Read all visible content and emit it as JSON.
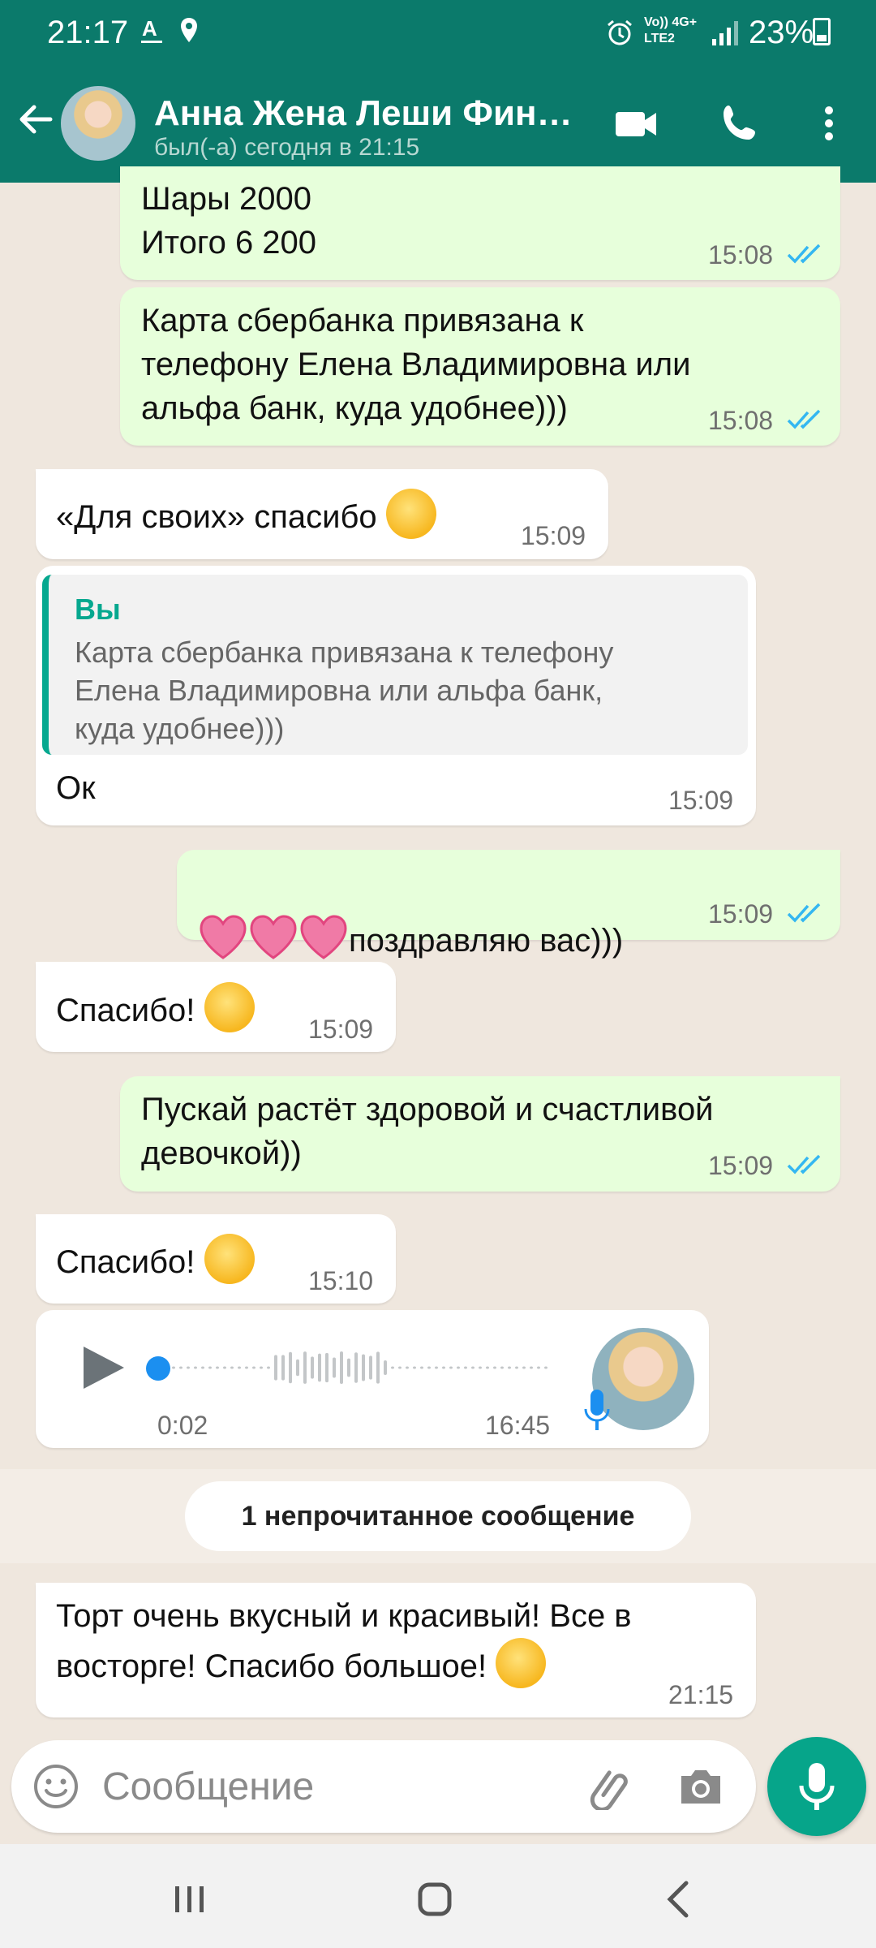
{
  "status_bar": {
    "time": "21:17",
    "network_top": "Vo)) 4G+",
    "network_bottom": "LTE2",
    "battery": "23%"
  },
  "header": {
    "contact_name": "Анна Жена Леши Фин…",
    "last_seen": "был(-а) сегодня в 21:15"
  },
  "messages": [
    {
      "id": "m1",
      "direction": "out",
      "text": "Шары 2000\nИтого 6 200",
      "time": "15:08",
      "status": "read"
    },
    {
      "id": "m2",
      "direction": "out",
      "text": "Карта сбербанка привязана к\nтелефону Елена Владимировна или\nальфа банк,  куда удобнее)))",
      "time": "15:08",
      "status": "read"
    },
    {
      "id": "m3",
      "direction": "in",
      "text": "«Для своих» спасибо",
      "emoji": "hugging-face",
      "time": "15:09"
    },
    {
      "id": "m4",
      "direction": "in",
      "quote_author": "Вы",
      "quote_text": "Карта сбербанка привязана к телефону\nЕлена Владимировна или альфа банк,\nкуда удобнее)))",
      "text": "Ок",
      "time": "15:09"
    },
    {
      "id": "m5",
      "direction": "out",
      "emoji": "pink-heart x3",
      "text": "поздравляю вас)))",
      "time": "15:09",
      "status": "read"
    },
    {
      "id": "m6",
      "direction": "in",
      "text": "Спасибо!",
      "emoji": "smiling-face",
      "time": "15:09"
    },
    {
      "id": "m7",
      "direction": "out",
      "text": "Пускай растёт здоровой и счастливой\nдевочкой))",
      "time": "15:09",
      "status": "read"
    },
    {
      "id": "m8",
      "direction": "in",
      "text": "Спасибо!",
      "emoji": "kissing-face",
      "time": "15:10"
    },
    {
      "id": "m9",
      "direction": "in",
      "type": "voice",
      "duration": "0:02",
      "time": "16:45",
      "progress": 0
    }
  ],
  "unread_divider": "1 непрочитанное сообщение",
  "last_message": {
    "direction": "in",
    "text": "Торт очень вкусный и красивый! Все в\nвосторге! Спасибо большое!",
    "emoji": "hugging-face",
    "time": "21:15"
  },
  "composer": {
    "placeholder": "Сообщение"
  },
  "colors": {
    "header": "#0b7a6b",
    "outgoing_bubble": "#e7ffdb",
    "incoming_bubble": "#ffffff",
    "accent": "#06a58a",
    "read_ticks": "#34b7f1"
  },
  "icons": [
    "back-arrow-icon",
    "video-call-icon",
    "phone-call-icon",
    "more-icon",
    "emoji-icon",
    "attach-icon",
    "camera-icon",
    "mic-icon",
    "play-icon",
    "recent-apps-icon",
    "home-icon",
    "nav-back-icon"
  ]
}
